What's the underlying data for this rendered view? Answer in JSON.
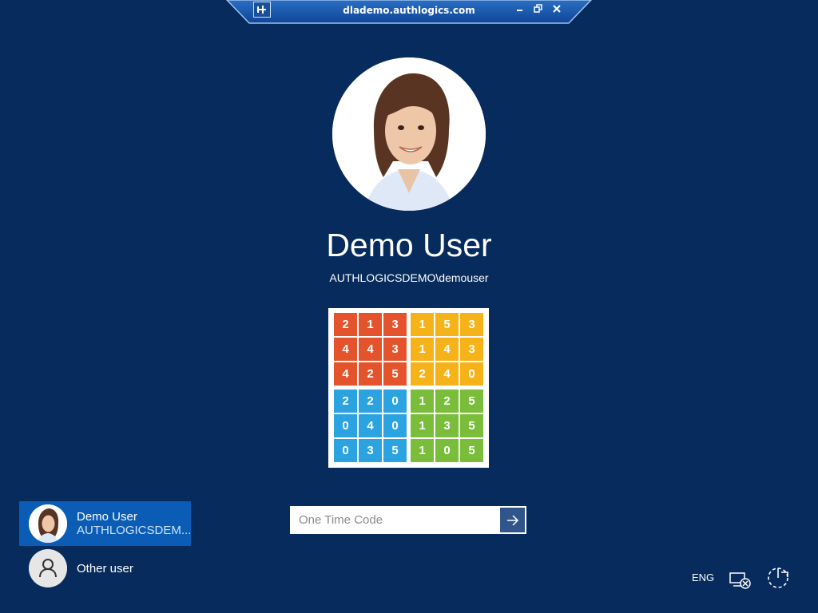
{
  "rdp": {
    "title": "dlademo.authlogics.com",
    "pin_icon": "pin-icon",
    "buttons": [
      "minimize-icon",
      "restore-icon",
      "close-icon"
    ]
  },
  "user": {
    "display_name": "Demo User",
    "account": "AUTHLOGICSDEMO\\demouser"
  },
  "grid": {
    "quadrants": [
      {
        "color": "#e4532c",
        "rows": [
          [
            "2",
            "1",
            "3"
          ],
          [
            "4",
            "4",
            "3"
          ],
          [
            "4",
            "2",
            "5"
          ]
        ]
      },
      {
        "color": "#f5b319",
        "rows": [
          [
            "1",
            "5",
            "3"
          ],
          [
            "1",
            "4",
            "3"
          ],
          [
            "2",
            "4",
            "0"
          ]
        ]
      },
      {
        "color": "#2aa3e0",
        "rows": [
          [
            "2",
            "2",
            "0"
          ],
          [
            "0",
            "4",
            "0"
          ],
          [
            "0",
            "3",
            "5"
          ]
        ]
      },
      {
        "color": "#79bd3a",
        "rows": [
          [
            "1",
            "2",
            "5"
          ],
          [
            "1",
            "3",
            "5"
          ],
          [
            "1",
            "0",
            "5"
          ]
        ]
      }
    ]
  },
  "otp": {
    "placeholder": "One Time Code",
    "value": "",
    "submit_icon": "arrow-right-icon"
  },
  "user_list": [
    {
      "name": "Demo User",
      "sub": "AUTHLOGICSDEM...",
      "selected": true
    },
    {
      "name": "Other user",
      "sub": "",
      "selected": false
    }
  ],
  "tray": {
    "language": "ENG",
    "icons": [
      "ease-of-access-icon",
      "power-icon"
    ]
  },
  "colors": {
    "background": "#062b5c",
    "selected_tile": "#0a5cb5",
    "submit_button": "#30558b"
  }
}
